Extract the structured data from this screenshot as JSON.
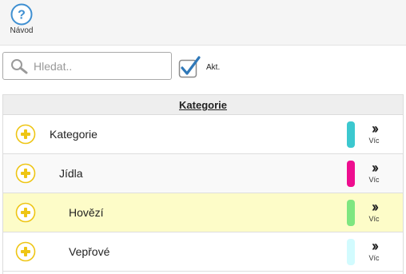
{
  "toolbar": {
    "help_label": "Návod"
  },
  "search": {
    "placeholder": "Hledat..",
    "value": ""
  },
  "filter": {
    "akt_label": "Akt.",
    "akt_checked": true
  },
  "table": {
    "header": "Kategorie",
    "more_label": "Víc",
    "rows": [
      {
        "label": "Kategorie",
        "color": "#3cc8cf"
      },
      {
        "label": "Jídla",
        "color": "#ee0e8f"
      },
      {
        "label": "Hovězí",
        "color": "#7ee680",
        "selected": true
      },
      {
        "label": "Vepřové",
        "color": "#d2fbfe"
      }
    ]
  },
  "colors": {
    "accent_blue": "#3e8fd1",
    "expand_yellow": "#eec514",
    "selected_row": "#fdfcc8"
  }
}
